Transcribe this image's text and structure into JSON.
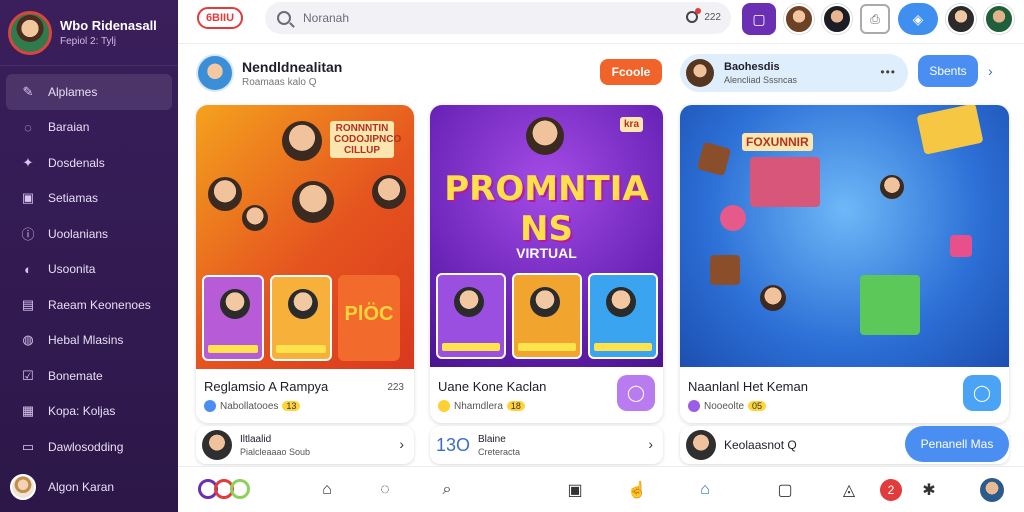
{
  "sidebar": {
    "profile_name": "Wbo Ridenasall",
    "profile_sub": "Fepiol 2: Tylj",
    "items": [
      {
        "label": "Alplames",
        "icon": "edit-icon"
      },
      {
        "label": "Baraian",
        "icon": "chat-icon"
      },
      {
        "label": "Dosdenals",
        "icon": "star-icon"
      },
      {
        "label": "Setiamas",
        "icon": "grid-icon"
      },
      {
        "label": "Uoolanians",
        "icon": "info-icon"
      },
      {
        "label": "Usoonita",
        "icon": "toggle-icon"
      },
      {
        "label": "Raeam Keonenoes",
        "icon": "box-icon"
      },
      {
        "label": "Hebal Mlasins",
        "icon": "globe-icon"
      },
      {
        "label": "Bonemate",
        "icon": "check-icon"
      },
      {
        "label": "Kopa: Koljas",
        "icon": "calendar-icon"
      },
      {
        "label": "Dawlosodding",
        "icon": "folder-icon"
      }
    ],
    "footer_name": "Algon Karan"
  },
  "topbar": {
    "brand": "6BIIU",
    "search_placeholder": "Noranah",
    "search_count": "222"
  },
  "channel": {
    "title": "Nendldnealitan",
    "sub": "Roamaas kalo Q"
  },
  "buttons": {
    "follow": "Fcoole",
    "share": "Sbents"
  },
  "user_card": {
    "name": "Baohesdis",
    "sub": "Alencliad Sssncas"
  },
  "cards": [
    {
      "title": "Reglamsio A Rampya",
      "sub": "Nabollatooes",
      "badge": "13",
      "corner": "223",
      "sign": "RONNNTIN\nCODOJIPNCO\nCILLUP",
      "tag": "PlÖC"
    },
    {
      "title": "Uane Kone Kaclan",
      "sub": "Nhamdlera",
      "badge": "18",
      "promo_line1": "PROMNTIA",
      "promo_line2": "NS",
      "promo_virtual": "VIRTUAL",
      "sign": "kra"
    },
    {
      "title": "Naanlanl Het Keman",
      "sub": "Nooeolte",
      "badge": "05",
      "sign": "FOXUNNIR"
    }
  ],
  "mini_cards": [
    {
      "line1": "Iltlaalid",
      "line2": "Pialcleaaao Soub"
    },
    {
      "num": "13O",
      "line1": "Blaine",
      "line2": "Creteracta"
    },
    {
      "line1": "Keolaasnot Q",
      "follow": "Penanell Mas"
    }
  ],
  "bottom_badge": "2"
}
